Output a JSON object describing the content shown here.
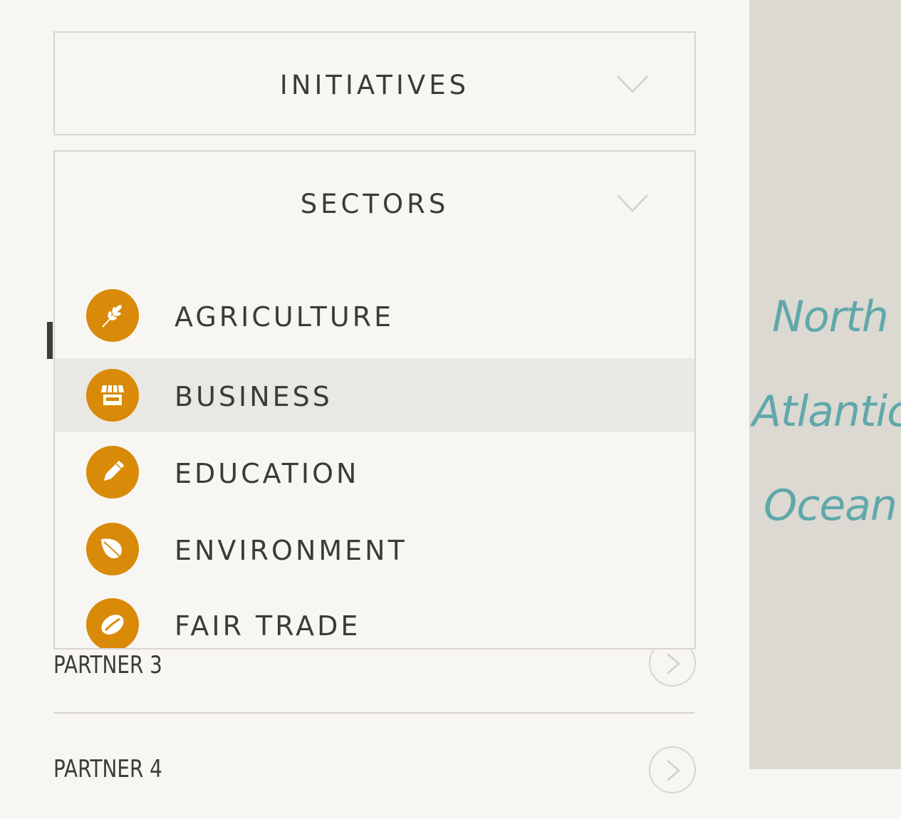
{
  "filters": {
    "initiatives": {
      "label": "INITIATIVES",
      "icon": "chevron-down-icon"
    },
    "sectors": {
      "label": "SECTORS",
      "icon": "chevron-down-icon",
      "expanded": true
    }
  },
  "sectors_menu": {
    "items": [
      {
        "label": "AGRICULTURE",
        "icon": "wheat-icon",
        "active": false
      },
      {
        "label": "BUSINESS",
        "icon": "storefront-icon",
        "active": true
      },
      {
        "label": "EDUCATION",
        "icon": "pencil-icon",
        "active": false
      },
      {
        "label": "ENVIRONMENT",
        "icon": "leaf-icon",
        "active": false
      },
      {
        "label": "FAIR TRADE",
        "icon": "coffee-bean-icon",
        "active": false
      }
    ],
    "icon_color": "#d98a08",
    "active_bg": "#eae8e3"
  },
  "partners": [
    {
      "label": "PARTNER 3"
    },
    {
      "label": "PARTNER 4"
    }
  ],
  "map": {
    "labels": [
      "North",
      "Atlantic",
      "Ocean"
    ],
    "label_color": "#5fa8aa",
    "background": "#cfcac3"
  }
}
